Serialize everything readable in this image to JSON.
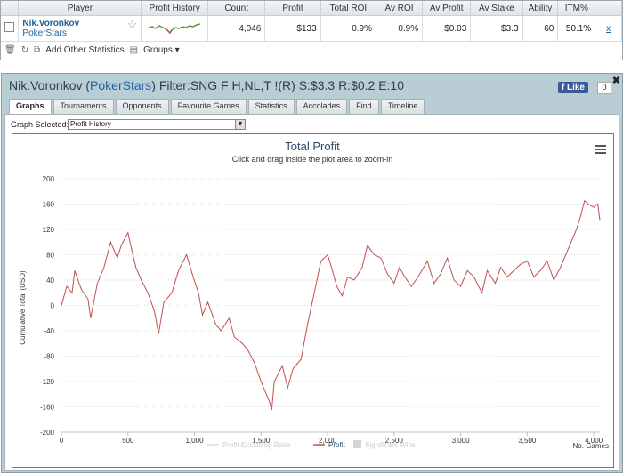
{
  "stats_table": {
    "headers": [
      "Player",
      "Profit History",
      "Count",
      "Profit",
      "Total ROI",
      "Av ROI",
      "Av Profit",
      "Av Stake",
      "Ability",
      "ITM%"
    ],
    "row": {
      "player_name": "Nik.Voronkov",
      "site": "PokerStars",
      "count": "4,046",
      "profit": "$133",
      "total_roi": "0.9%",
      "av_roi": "0.9%",
      "av_profit": "$0.03",
      "av_stake": "$3.3",
      "ability": "60",
      "itm": "50.1%",
      "remove_link": "x"
    }
  },
  "toolbar": {
    "add_stats_label": "Add Other Statistics",
    "groups_label": "Groups"
  },
  "panel": {
    "title_prefix": "Nik.Voronkov (",
    "title_site": "PokerStars",
    "title_suffix": ") Filter:SNG F H,NL,T !(R) S:$3.3 R:$0.2 E:10",
    "like_label": "Like",
    "like_count": "0",
    "close_label": "✖"
  },
  "tabs": [
    "Graphs",
    "Tournaments",
    "Opponents",
    "Favourite Games",
    "Statistics",
    "Accolades",
    "Find",
    "Timeline"
  ],
  "graph_select": {
    "label": "Graph Selected:",
    "value": "Profit History"
  },
  "chart_data": {
    "type": "line",
    "title": "Total Profit",
    "subtitle": "Click and drag inside the plot area to zoom-in",
    "ylabel": "Cumulative Total (USD)",
    "xlabel": "No. Games",
    "xlim": [
      0,
      4046
    ],
    "ylim": [
      -200,
      200
    ],
    "x_ticks": [
      "0",
      "500",
      "1,000",
      "1,500",
      "2,000",
      "2,500",
      "3,000",
      "3,500",
      "4,000"
    ],
    "y_ticks": [
      "200",
      "160",
      "120",
      "80",
      "40",
      "0",
      "-40",
      "-80",
      "-120",
      "-160",
      "-200"
    ],
    "legend": [
      "Profit Excluding Rake",
      "Profit",
      "Significant Wins"
    ],
    "series": [
      {
        "name": "Profit",
        "color": "#c0504d",
        "x": [
          0,
          40,
          80,
          100,
          150,
          200,
          220,
          270,
          320,
          370,
          420,
          450,
          500,
          520,
          560,
          600,
          650,
          700,
          730,
          770,
          830,
          880,
          940,
          990,
          1030,
          1060,
          1100,
          1160,
          1200,
          1260,
          1300,
          1360,
          1400,
          1450,
          1500,
          1560,
          1580,
          1600,
          1660,
          1700,
          1740,
          1800,
          1850,
          1900,
          1950,
          2000,
          2030,
          2070,
          2110,
          2150,
          2200,
          2260,
          2300,
          2350,
          2400,
          2450,
          2500,
          2540,
          2580,
          2630,
          2680,
          2750,
          2800,
          2850,
          2900,
          2950,
          3000,
          3050,
          3100,
          3160,
          3200,
          3260,
          3300,
          3350,
          3400,
          3450,
          3500,
          3550,
          3600,
          3650,
          3700,
          3750,
          3790,
          3830,
          3870,
          3900,
          3930,
          3960,
          4000,
          4030,
          4046
        ],
        "values": [
          0,
          30,
          20,
          55,
          25,
          10,
          -20,
          35,
          60,
          100,
          75,
          95,
          115,
          95,
          60,
          40,
          20,
          -10,
          -45,
          5,
          20,
          55,
          80,
          45,
          20,
          -15,
          5,
          -30,
          -40,
          -20,
          -50,
          -60,
          -70,
          -90,
          -120,
          -150,
          -165,
          -120,
          -95,
          -130,
          -100,
          -85,
          -30,
          20,
          70,
          80,
          60,
          30,
          15,
          45,
          40,
          60,
          95,
          80,
          75,
          50,
          35,
          60,
          45,
          30,
          45,
          70,
          35,
          50,
          75,
          40,
          30,
          55,
          45,
          20,
          55,
          35,
          60,
          45,
          55,
          65,
          70,
          45,
          55,
          70,
          40,
          60,
          80,
          100,
          120,
          140,
          165,
          160,
          155,
          160,
          135
        ]
      }
    ]
  }
}
